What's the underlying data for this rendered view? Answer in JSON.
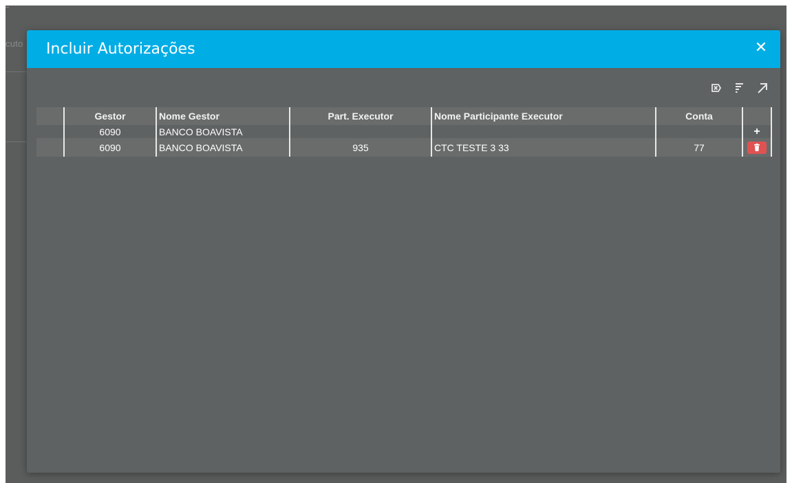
{
  "background": {
    "partial_label": "cuto"
  },
  "modal": {
    "title": "Incluir Autorizações",
    "close_label": "✕"
  },
  "toolbar": {
    "clear_filter_icon": "clear-filter-icon",
    "sort_icon": "sort-icon",
    "expand_icon": "expand-icon"
  },
  "grid": {
    "columns": [
      "",
      "Gestor",
      "Nome Gestor",
      "Part. Executor",
      "Nome Participante Executor",
      "Conta",
      ""
    ],
    "rows": [
      {
        "gestor": "6090",
        "nome_gestor": "BANCO BOAVISTA",
        "part_executor": "",
        "nome_participante_executor": "",
        "conta": "",
        "action": "+"
      },
      {
        "gestor": "6090",
        "nome_gestor": "BANCO BOAVISTA",
        "part_executor": "935",
        "nome_participante_executor": "CTC TESTE 3 33",
        "conta": "77",
        "action": "delete"
      }
    ]
  },
  "colors": {
    "header": "#00ade5",
    "delete": "#e05252",
    "modal_bg": "#5f6262"
  }
}
